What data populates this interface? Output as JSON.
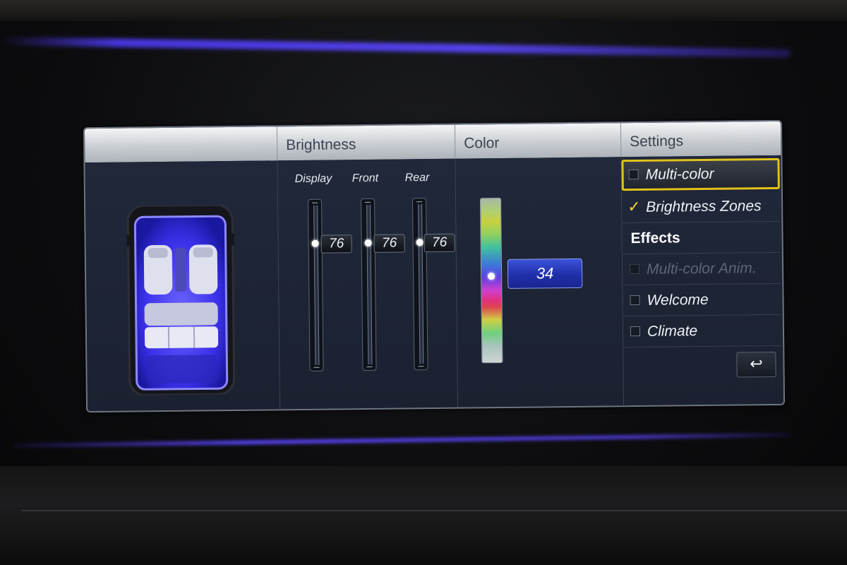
{
  "tabs": {
    "brightness": "Brightness",
    "color": "Color",
    "settings": "Settings"
  },
  "brightness": {
    "sliders": [
      {
        "label": "Display",
        "value": "76"
      },
      {
        "label": "Front",
        "value": "76"
      },
      {
        "label": "Rear",
        "value": "76"
      }
    ],
    "max": 100
  },
  "color": {
    "value": "34"
  },
  "settings": {
    "items": [
      {
        "label": "Multi-color",
        "checked": false,
        "selected": true
      },
      {
        "label": "Brightness Zones",
        "checked": true
      },
      {
        "label": "Effects",
        "header": true
      },
      {
        "label": "Multi-color Anim.",
        "checked": false,
        "disabled": true
      },
      {
        "label": "Welcome",
        "checked": false
      },
      {
        "label": "Climate",
        "checked": false
      }
    ],
    "back_icon": "↩"
  },
  "colors": {
    "ambient": "#5a46ff",
    "selection": "#e2c21a",
    "color_value_bg": "#2a3cc0"
  }
}
